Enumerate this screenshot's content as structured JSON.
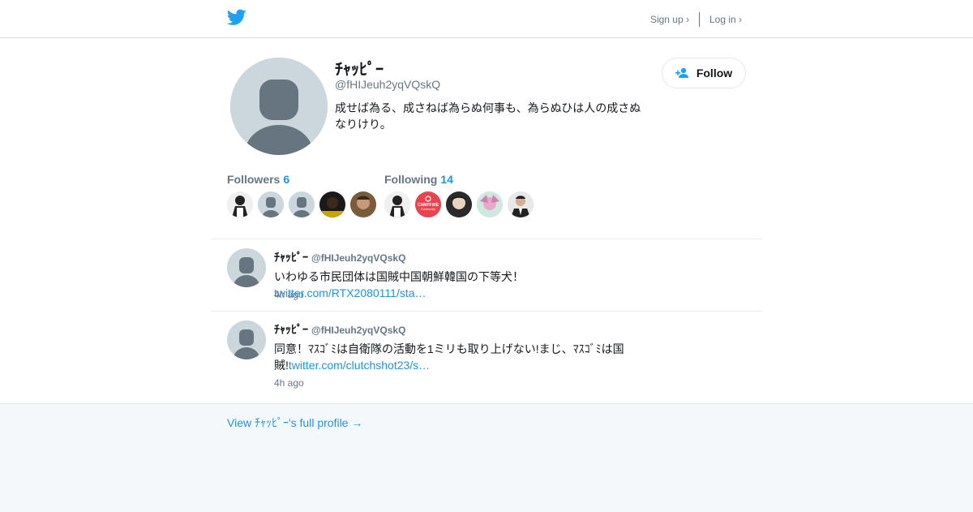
{
  "header": {
    "signup": "Sign up ›",
    "login": "Log in ›"
  },
  "profile": {
    "name": "ﾁｬｯﾋﾟｰ",
    "handle": "@fHIJeuh2yqVQskQ",
    "bio": "成せば為る、成さねば為らぬ何事も、為らぬひは人の成さぬなりけり。",
    "follow_label": "Follow",
    "followers_label": "Followers",
    "followers_count": "6",
    "following_label": "Following",
    "following_count": "14",
    "campfire_text": "CAMPFIRE",
    "campfire_sub": "Community"
  },
  "tweets": [
    {
      "name": "ﾁｬｯﾋﾟｰ",
      "handle": "@fHIJeuh2yqVQskQ",
      "text": "いわゆる市民団体は国賊中国朝鮮韓国の下等犬！",
      "link": "twitter.com/RTX2080111/sta…",
      "time": "4h ago"
    },
    {
      "name": "ﾁｬｯﾋﾟｰ",
      "handle": "@fHIJeuh2yqVQskQ",
      "text": "同意！ﾏｽｺﾞﾐは自衛隊の活動を1ミリも取り上げない!まじ、ﾏｽｺﾞﾐは国賊!",
      "link": "twitter.com/clutchshot23/s…",
      "time": "4h ago"
    }
  ],
  "footer": {
    "full_profile": "View ﾁｬｯﾋﾟｰ's full profile →"
  },
  "colors": {
    "link": "#1b95e0",
    "brand": "#1da1f2",
    "muted": "#657786"
  }
}
